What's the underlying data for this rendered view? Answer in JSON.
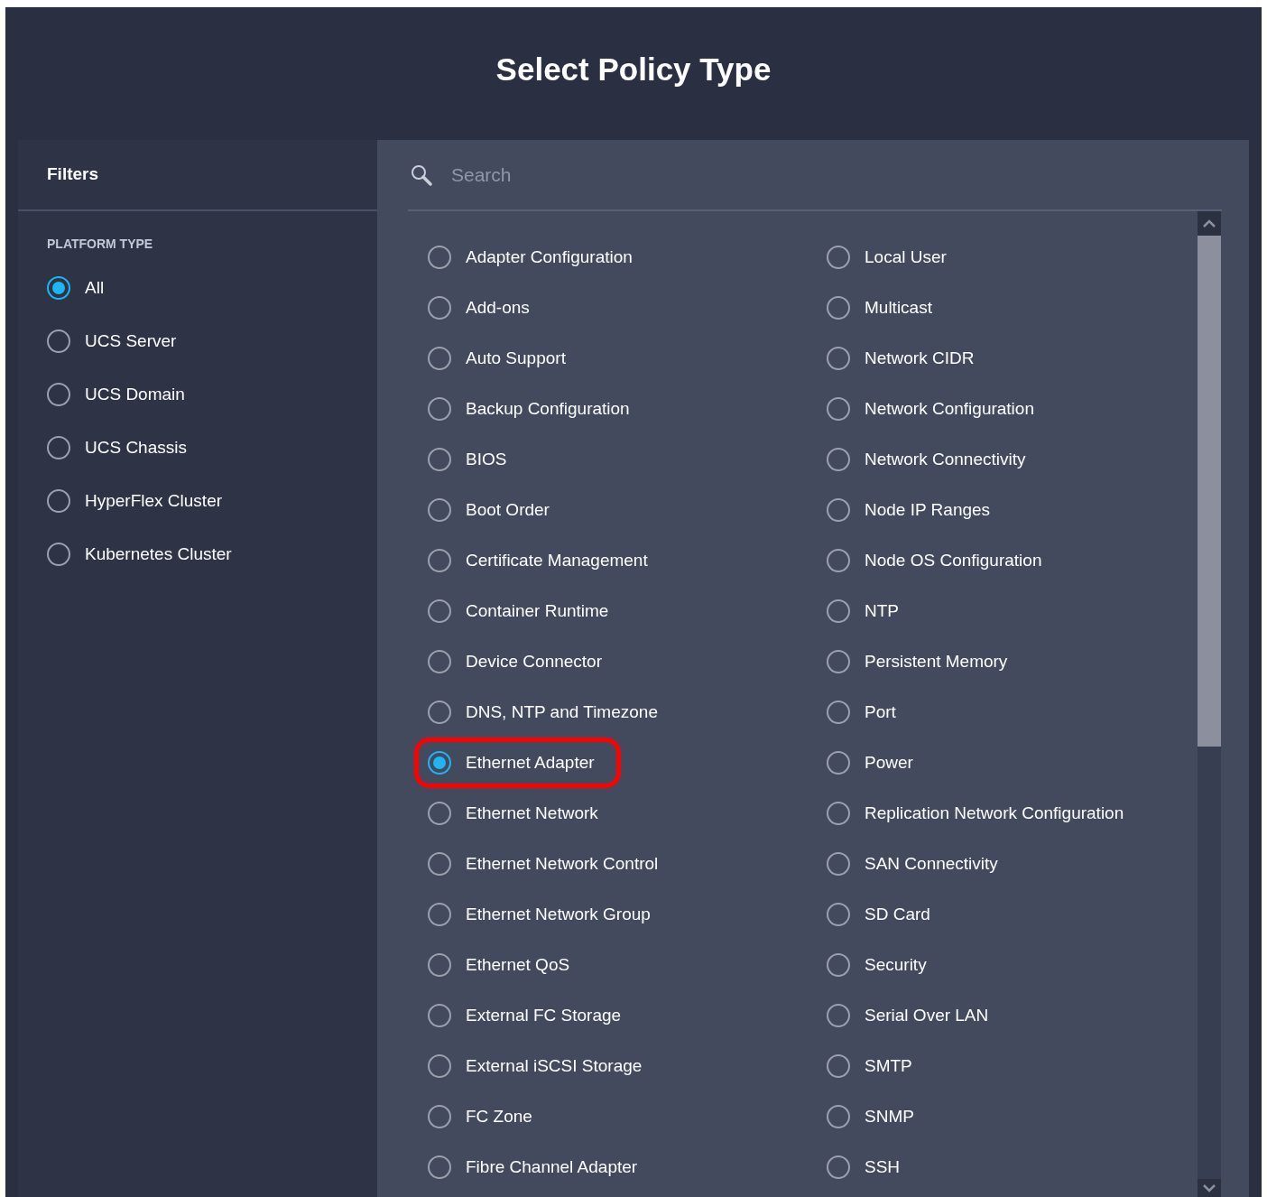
{
  "title": "Select Policy Type",
  "filters": {
    "heading": "Filters",
    "section": "PLATFORM TYPE",
    "options": [
      {
        "label": "All",
        "selected": true
      },
      {
        "label": "UCS Server",
        "selected": false
      },
      {
        "label": "UCS Domain",
        "selected": false
      },
      {
        "label": "UCS Chassis",
        "selected": false
      },
      {
        "label": "HyperFlex Cluster",
        "selected": false
      },
      {
        "label": "Kubernetes Cluster",
        "selected": false
      }
    ]
  },
  "search": {
    "placeholder": "Search"
  },
  "policy_types": [
    {
      "label": "Adapter Configuration",
      "selected": false,
      "highlighted": false
    },
    {
      "label": "Add-ons",
      "selected": false,
      "highlighted": false
    },
    {
      "label": "Auto Support",
      "selected": false,
      "highlighted": false
    },
    {
      "label": "Backup Configuration",
      "selected": false,
      "highlighted": false
    },
    {
      "label": "BIOS",
      "selected": false,
      "highlighted": false
    },
    {
      "label": "Boot Order",
      "selected": false,
      "highlighted": false
    },
    {
      "label": "Certificate Management",
      "selected": false,
      "highlighted": false
    },
    {
      "label": "Container Runtime",
      "selected": false,
      "highlighted": false
    },
    {
      "label": "Device Connector",
      "selected": false,
      "highlighted": false
    },
    {
      "label": "DNS, NTP and Timezone",
      "selected": false,
      "highlighted": false
    },
    {
      "label": "Ethernet Adapter",
      "selected": true,
      "highlighted": true
    },
    {
      "label": "Ethernet Network",
      "selected": false,
      "highlighted": false
    },
    {
      "label": "Ethernet Network Control",
      "selected": false,
      "highlighted": false
    },
    {
      "label": "Ethernet Network Group",
      "selected": false,
      "highlighted": false
    },
    {
      "label": "Ethernet QoS",
      "selected": false,
      "highlighted": false
    },
    {
      "label": "External FC Storage",
      "selected": false,
      "highlighted": false
    },
    {
      "label": "External iSCSI Storage",
      "selected": false,
      "highlighted": false
    },
    {
      "label": "FC Zone",
      "selected": false,
      "highlighted": false
    },
    {
      "label": "Fibre Channel Adapter",
      "selected": false,
      "highlighted": false
    },
    {
      "label": "Local User",
      "selected": false,
      "highlighted": false
    },
    {
      "label": "Multicast",
      "selected": false,
      "highlighted": false
    },
    {
      "label": "Network CIDR",
      "selected": false,
      "highlighted": false
    },
    {
      "label": "Network Configuration",
      "selected": false,
      "highlighted": false
    },
    {
      "label": "Network Connectivity",
      "selected": false,
      "highlighted": false
    },
    {
      "label": "Node IP Ranges",
      "selected": false,
      "highlighted": false
    },
    {
      "label": "Node OS Configuration",
      "selected": false,
      "highlighted": false
    },
    {
      "label": "NTP",
      "selected": false,
      "highlighted": false
    },
    {
      "label": "Persistent Memory",
      "selected": false,
      "highlighted": false
    },
    {
      "label": "Port",
      "selected": false,
      "highlighted": false
    },
    {
      "label": "Power",
      "selected": false,
      "highlighted": false
    },
    {
      "label": "Replication Network Configuration",
      "selected": false,
      "highlighted": false
    },
    {
      "label": "SAN Connectivity",
      "selected": false,
      "highlighted": false
    },
    {
      "label": "SD Card",
      "selected": false,
      "highlighted": false
    },
    {
      "label": "Security",
      "selected": false,
      "highlighted": false
    },
    {
      "label": "Serial Over LAN",
      "selected": false,
      "highlighted": false
    },
    {
      "label": "SMTP",
      "selected": false,
      "highlighted": false
    },
    {
      "label": "SNMP",
      "selected": false,
      "highlighted": false
    },
    {
      "label": "SSH",
      "selected": false,
      "highlighted": false
    }
  ]
}
